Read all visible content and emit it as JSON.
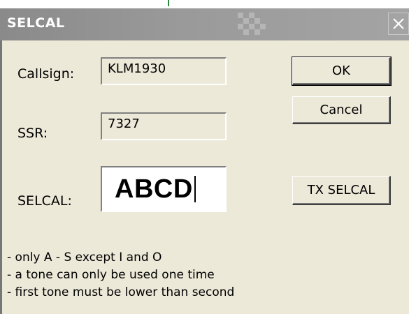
{
  "window": {
    "title": "SELCAL"
  },
  "form": {
    "callsign_label": "Callsign:",
    "callsign_value": "KLM1930",
    "ssr_label": "SSR:",
    "ssr_value": "7327",
    "selcal_label": "SELCAL:",
    "selcal_value": "ABCD"
  },
  "buttons": {
    "ok": "OK",
    "cancel": "Cancel",
    "tx_selcal": "TX SELCAL"
  },
  "notes": [
    "- only A - S except I and O",
    "- a tone can only be used one time",
    "- first tone must be lower than second"
  ],
  "icons": {
    "close": "close-icon"
  },
  "colors": {
    "dialog_bg": "#ece9d8",
    "titlebar": "#9a9a9a",
    "title_text": "#ffffff"
  }
}
